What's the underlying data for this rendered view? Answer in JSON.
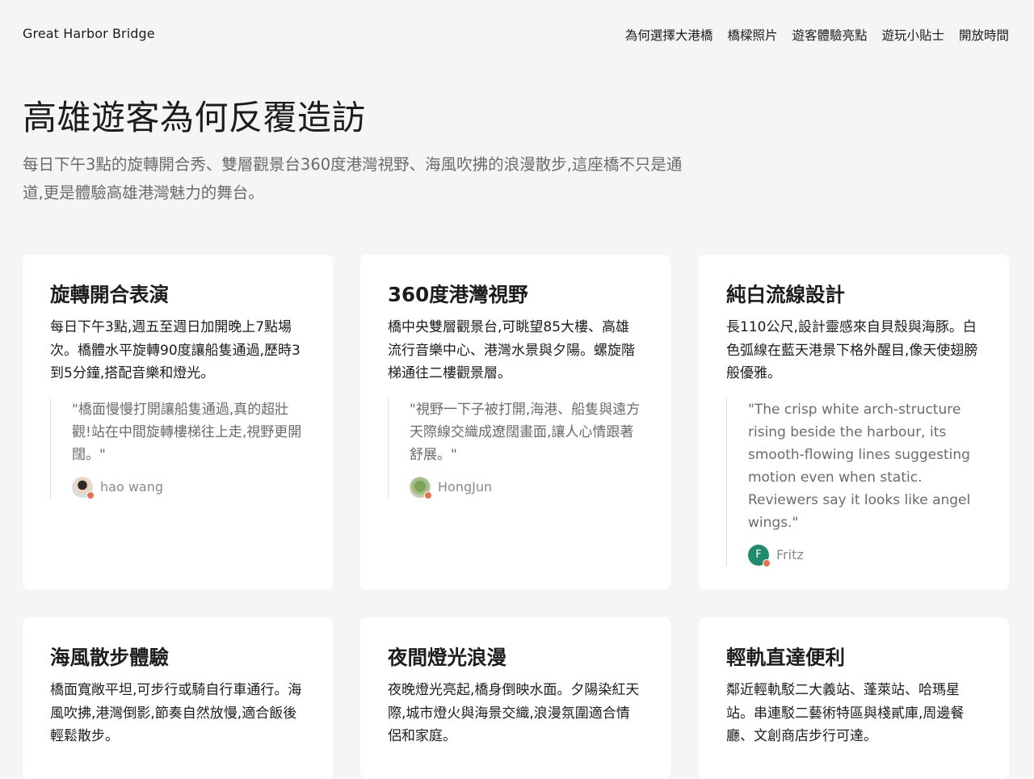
{
  "header": {
    "brand": "Great Harbor Bridge",
    "nav": [
      "為何選擇大港橋",
      "橋樑照片",
      "遊客體驗亮點",
      "遊玩小貼士",
      "開放時間"
    ]
  },
  "hero": {
    "title": "高雄遊客為何反覆造訪",
    "subtitle": "每日下午3點的旋轉開合秀、雙層觀景台360度港灣視野、海風吹拂的浪漫散步,這座橋不只是通道,更是體驗高雄港灣魅力的舞台。"
  },
  "cards": [
    {
      "title": "旋轉開合表演",
      "desc": "每日下午3點,週五至週日加開晚上7點場次。橋體水平旋轉90度讓船隻通過,歷時3到5分鐘,搭配音樂和燈光。",
      "quote": "\"橋面慢慢打開讓船隻通過,真的超壯觀!站在中間旋轉樓梯往上走,視野更開闊。\"",
      "reviewer": "hao wang",
      "avatar_icon": "photo-avatar-icon",
      "avatar_initial": ""
    },
    {
      "title": "360度港灣視野",
      "desc": "橋中央雙層觀景台,可眺望85大樓、高雄流行音樂中心、港灣水景與夕陽。螺旋階梯通往二樓觀景層。",
      "quote": "\"視野一下子被打開,海港、船隻與遠方天際線交織成遼闊畫面,讓人心情跟著舒展。\"",
      "reviewer": "HongJun",
      "avatar_icon": "photo-avatar-icon",
      "avatar_initial": ""
    },
    {
      "title": "純白流線設計",
      "desc": "長110公尺,設計靈感來自貝殼與海豚。白色弧線在藍天港景下格外醒目,像天使翅膀般優雅。",
      "quote": "\"The crisp white arch-structure rising beside the harbour, its smooth-flowing lines suggesting motion even when static. Reviewers say it looks like angel wings.\"",
      "reviewer": "Fritz",
      "avatar_icon": "initial-avatar-icon",
      "avatar_initial": "F"
    },
    {
      "title": "海風散步體驗",
      "desc": "橋面寬敞平坦,可步行或騎自行車通行。海風吹拂,港灣倒影,節奏自然放慢,適合飯後輕鬆散步。"
    },
    {
      "title": "夜間燈光浪漫",
      "desc": "夜晚燈光亮起,橋身倒映水面。夕陽染紅天際,城市燈火與海景交織,浪漫氛圍適合情侶和家庭。"
    },
    {
      "title": "輕軌直達便利",
      "desc": "鄰近輕軌駁二大義站、蓬萊站、哈瑪星站。串連駁二藝術特區與棧貳庫,周邊餐廳、文創商店步行可達。"
    }
  ]
}
